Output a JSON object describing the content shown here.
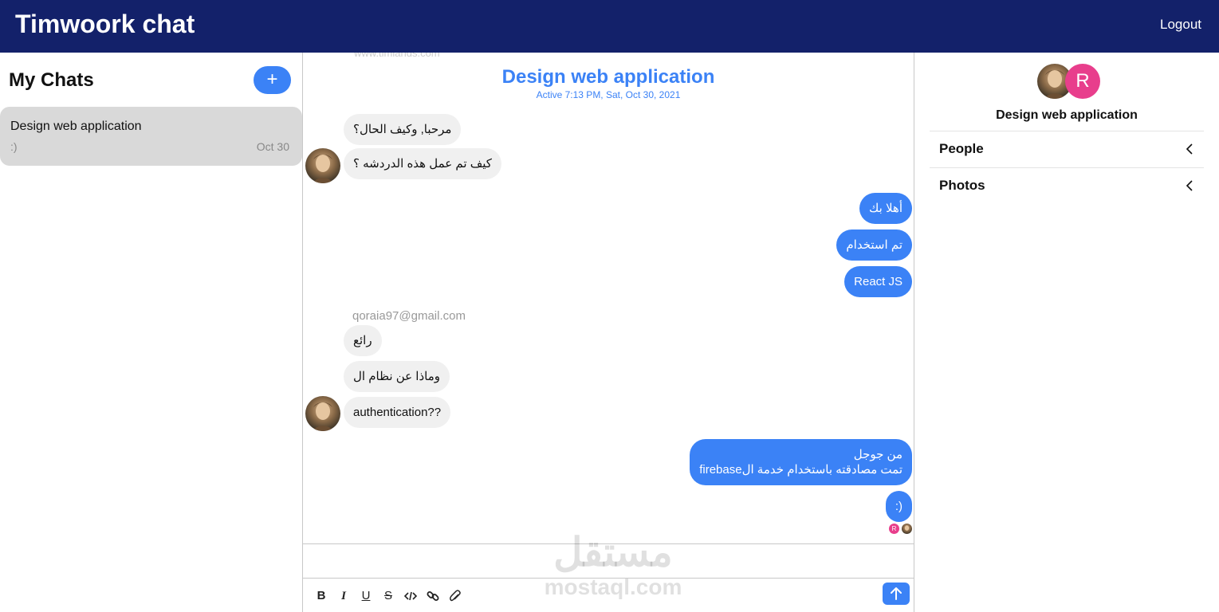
{
  "header": {
    "app_title": "Timwoork chat",
    "logout_label": "Logout"
  },
  "sidebar": {
    "title": "My Chats",
    "new_chat_label": "+",
    "chats": [
      {
        "title": "Design web application",
        "last_message": ":)",
        "date": "Oct 30"
      }
    ]
  },
  "chat": {
    "title": "Design web application",
    "active_status": "Active 7:13 PM, Sat, Oct 30, 2021",
    "faded_text": "www.timlands.com",
    "sender_email": "qoraia97@gmail.com",
    "messages": [
      {
        "text": "مرحبا, وكيف الحال؟",
        "direction": "in"
      },
      {
        "text": "كيف تم عمل هذه الدردشه ؟",
        "direction": "in"
      },
      {
        "text": "أهلا بك",
        "direction": "out"
      },
      {
        "text": "تم استخدام",
        "direction": "out"
      },
      {
        "text": "React JS",
        "direction": "out"
      },
      {
        "text": "رائع",
        "direction": "in"
      },
      {
        "text": "وماذا عن نظام ال",
        "direction": "in"
      },
      {
        "text": "authentication??",
        "direction": "in"
      },
      {
        "text_line1": "من جوجل",
        "text_line2": "تمت مصادقته باستخدام خدمة الfirebase",
        "direction": "out"
      },
      {
        "text": ":)",
        "direction": "out"
      }
    ],
    "read_receipt_letter": "R"
  },
  "composer": {
    "tools": [
      "bold-icon",
      "italic-icon",
      "underline-icon",
      "strikethrough-icon",
      "code-icon",
      "link-icon",
      "attachment-icon"
    ],
    "send_icon": "arrow-up-icon"
  },
  "watermark": {
    "arabic": "مستقل",
    "latin": "mostaql.com"
  },
  "details": {
    "avatar_letter": "R",
    "title": "Design web application",
    "sections": [
      {
        "label": "People"
      },
      {
        "label": "Photos"
      }
    ]
  },
  "colors": {
    "header_bg": "#13216a",
    "accent": "#3b82f6",
    "avatar_pink": "#e83e8c",
    "bubble_in": "#f0f0f0"
  }
}
